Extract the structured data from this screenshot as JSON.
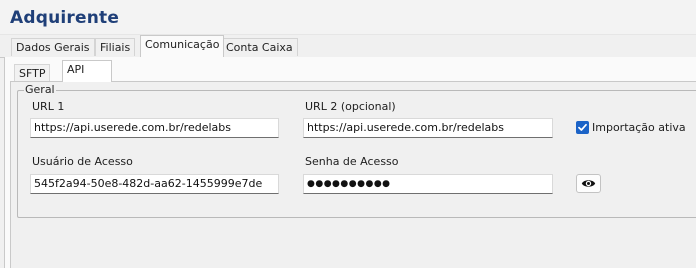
{
  "header": {
    "title": "Adquirente"
  },
  "tabs": [
    {
      "label": "Dados Gerais"
    },
    {
      "label": "Filiais"
    },
    {
      "label": "Comunicação"
    },
    {
      "label": "Conta Caixa"
    }
  ],
  "active_tab": "Comunicação",
  "subtabs": [
    {
      "label": "SFTP"
    },
    {
      "label": "API"
    }
  ],
  "active_subtab": "API",
  "group": {
    "label": "Geral",
    "url1": {
      "label": "URL 1",
      "value": "https://api.userede.com.br/redelabs"
    },
    "url2": {
      "label": "URL 2 (opcional)",
      "value": "https://api.userede.com.br/redelabs"
    },
    "import_checkbox": {
      "label": "Importação ativa",
      "checked": true
    },
    "user": {
      "label": "Usuário de Acesso",
      "value": "545f2a94-50e8-482d-aa62-1455999e7de"
    },
    "password": {
      "label": "Senha de Acesso",
      "value": "●●●●●●●●●●"
    },
    "show_password_icon": "eye-icon"
  },
  "colors": {
    "title": "#1f3f78",
    "checkbox": "#1b63c7"
  }
}
